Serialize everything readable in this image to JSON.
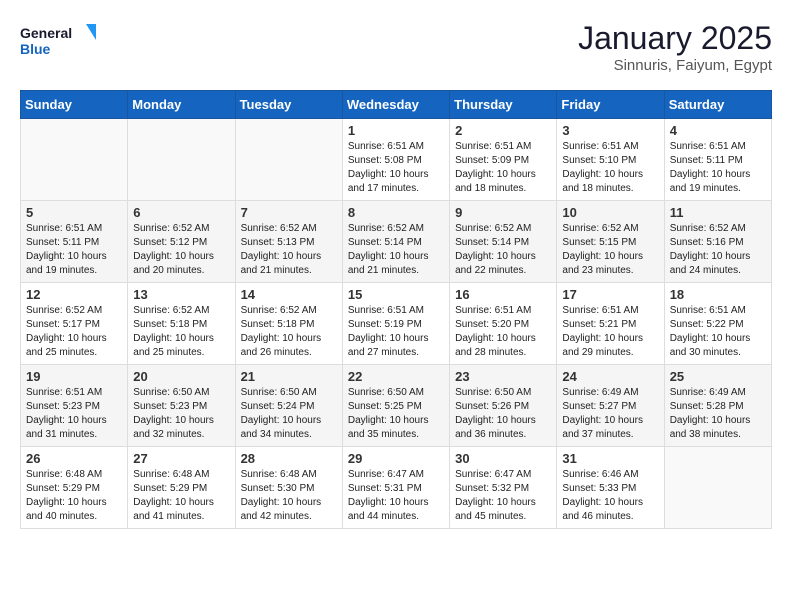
{
  "logo": {
    "line1": "General",
    "line2": "Blue"
  },
  "title": "January 2025",
  "location": "Sinnuris, Faiyum, Egypt",
  "weekdays": [
    "Sunday",
    "Monday",
    "Tuesday",
    "Wednesday",
    "Thursday",
    "Friday",
    "Saturday"
  ],
  "weeks": [
    [
      {
        "day": "",
        "info": ""
      },
      {
        "day": "",
        "info": ""
      },
      {
        "day": "",
        "info": ""
      },
      {
        "day": "1",
        "info": "Sunrise: 6:51 AM\nSunset: 5:08 PM\nDaylight: 10 hours and 17 minutes."
      },
      {
        "day": "2",
        "info": "Sunrise: 6:51 AM\nSunset: 5:09 PM\nDaylight: 10 hours and 18 minutes."
      },
      {
        "day": "3",
        "info": "Sunrise: 6:51 AM\nSunset: 5:10 PM\nDaylight: 10 hours and 18 minutes."
      },
      {
        "day": "4",
        "info": "Sunrise: 6:51 AM\nSunset: 5:11 PM\nDaylight: 10 hours and 19 minutes."
      }
    ],
    [
      {
        "day": "5",
        "info": "Sunrise: 6:51 AM\nSunset: 5:11 PM\nDaylight: 10 hours and 19 minutes."
      },
      {
        "day": "6",
        "info": "Sunrise: 6:52 AM\nSunset: 5:12 PM\nDaylight: 10 hours and 20 minutes."
      },
      {
        "day": "7",
        "info": "Sunrise: 6:52 AM\nSunset: 5:13 PM\nDaylight: 10 hours and 21 minutes."
      },
      {
        "day": "8",
        "info": "Sunrise: 6:52 AM\nSunset: 5:14 PM\nDaylight: 10 hours and 21 minutes."
      },
      {
        "day": "9",
        "info": "Sunrise: 6:52 AM\nSunset: 5:14 PM\nDaylight: 10 hours and 22 minutes."
      },
      {
        "day": "10",
        "info": "Sunrise: 6:52 AM\nSunset: 5:15 PM\nDaylight: 10 hours and 23 minutes."
      },
      {
        "day": "11",
        "info": "Sunrise: 6:52 AM\nSunset: 5:16 PM\nDaylight: 10 hours and 24 minutes."
      }
    ],
    [
      {
        "day": "12",
        "info": "Sunrise: 6:52 AM\nSunset: 5:17 PM\nDaylight: 10 hours and 25 minutes."
      },
      {
        "day": "13",
        "info": "Sunrise: 6:52 AM\nSunset: 5:18 PM\nDaylight: 10 hours and 25 minutes."
      },
      {
        "day": "14",
        "info": "Sunrise: 6:52 AM\nSunset: 5:18 PM\nDaylight: 10 hours and 26 minutes."
      },
      {
        "day": "15",
        "info": "Sunrise: 6:51 AM\nSunset: 5:19 PM\nDaylight: 10 hours and 27 minutes."
      },
      {
        "day": "16",
        "info": "Sunrise: 6:51 AM\nSunset: 5:20 PM\nDaylight: 10 hours and 28 minutes."
      },
      {
        "day": "17",
        "info": "Sunrise: 6:51 AM\nSunset: 5:21 PM\nDaylight: 10 hours and 29 minutes."
      },
      {
        "day": "18",
        "info": "Sunrise: 6:51 AM\nSunset: 5:22 PM\nDaylight: 10 hours and 30 minutes."
      }
    ],
    [
      {
        "day": "19",
        "info": "Sunrise: 6:51 AM\nSunset: 5:23 PM\nDaylight: 10 hours and 31 minutes."
      },
      {
        "day": "20",
        "info": "Sunrise: 6:50 AM\nSunset: 5:23 PM\nDaylight: 10 hours and 32 minutes."
      },
      {
        "day": "21",
        "info": "Sunrise: 6:50 AM\nSunset: 5:24 PM\nDaylight: 10 hours and 34 minutes."
      },
      {
        "day": "22",
        "info": "Sunrise: 6:50 AM\nSunset: 5:25 PM\nDaylight: 10 hours and 35 minutes."
      },
      {
        "day": "23",
        "info": "Sunrise: 6:50 AM\nSunset: 5:26 PM\nDaylight: 10 hours and 36 minutes."
      },
      {
        "day": "24",
        "info": "Sunrise: 6:49 AM\nSunset: 5:27 PM\nDaylight: 10 hours and 37 minutes."
      },
      {
        "day": "25",
        "info": "Sunrise: 6:49 AM\nSunset: 5:28 PM\nDaylight: 10 hours and 38 minutes."
      }
    ],
    [
      {
        "day": "26",
        "info": "Sunrise: 6:48 AM\nSunset: 5:29 PM\nDaylight: 10 hours and 40 minutes."
      },
      {
        "day": "27",
        "info": "Sunrise: 6:48 AM\nSunset: 5:29 PM\nDaylight: 10 hours and 41 minutes."
      },
      {
        "day": "28",
        "info": "Sunrise: 6:48 AM\nSunset: 5:30 PM\nDaylight: 10 hours and 42 minutes."
      },
      {
        "day": "29",
        "info": "Sunrise: 6:47 AM\nSunset: 5:31 PM\nDaylight: 10 hours and 44 minutes."
      },
      {
        "day": "30",
        "info": "Sunrise: 6:47 AM\nSunset: 5:32 PM\nDaylight: 10 hours and 45 minutes."
      },
      {
        "day": "31",
        "info": "Sunrise: 6:46 AM\nSunset: 5:33 PM\nDaylight: 10 hours and 46 minutes."
      },
      {
        "day": "",
        "info": ""
      }
    ]
  ]
}
